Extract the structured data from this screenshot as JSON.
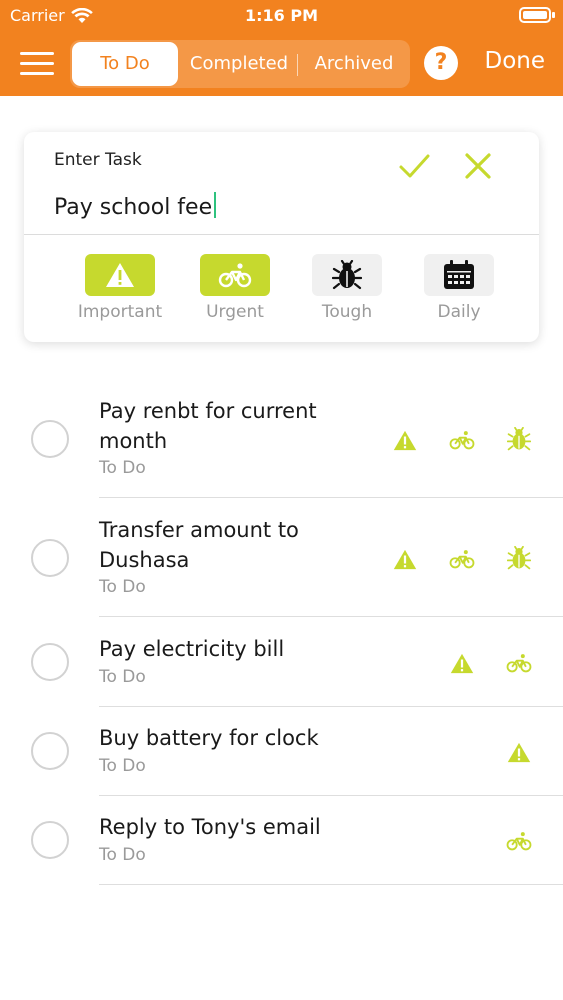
{
  "status_bar": {
    "carrier": "Carrier",
    "time": "1:16 PM"
  },
  "nav": {
    "tabs": [
      {
        "label": "To Do",
        "active": true
      },
      {
        "label": "Completed",
        "active": false
      },
      {
        "label": "Archived",
        "active": false
      }
    ],
    "help_label": "?",
    "done_label": "Done"
  },
  "task_entry": {
    "label": "Enter Task",
    "value": "Pay school fee",
    "flags": [
      {
        "label": "Important",
        "icon": "warning-icon",
        "selected": true
      },
      {
        "label": "Urgent",
        "icon": "bicycle-icon",
        "selected": true
      },
      {
        "label": "Tough",
        "icon": "bug-icon",
        "selected": false
      },
      {
        "label": "Daily",
        "icon": "calendar-icon",
        "selected": false
      }
    ]
  },
  "tasks": [
    {
      "title": "Pay renbt for current month",
      "status": "To Do",
      "flags": [
        "warning-icon",
        "bicycle-icon",
        "bug-icon"
      ]
    },
    {
      "title": "Transfer amount to Dushasa",
      "status": "To Do",
      "flags": [
        "warning-icon",
        "bicycle-icon",
        "bug-icon"
      ]
    },
    {
      "title": "Pay electricity bill",
      "status": "To Do",
      "flags": [
        "warning-icon",
        "bicycle-icon"
      ]
    },
    {
      "title": "Buy battery for clock",
      "status": "To Do",
      "flags": [
        "warning-icon"
      ]
    },
    {
      "title": "Reply to Tony's email",
      "status": "To Do",
      "flags": [
        "bicycle-icon"
      ]
    }
  ],
  "colors": {
    "accent": "#f2821f",
    "flag_green": "#c6d92e",
    "muted_text": "#9a9a9a"
  }
}
